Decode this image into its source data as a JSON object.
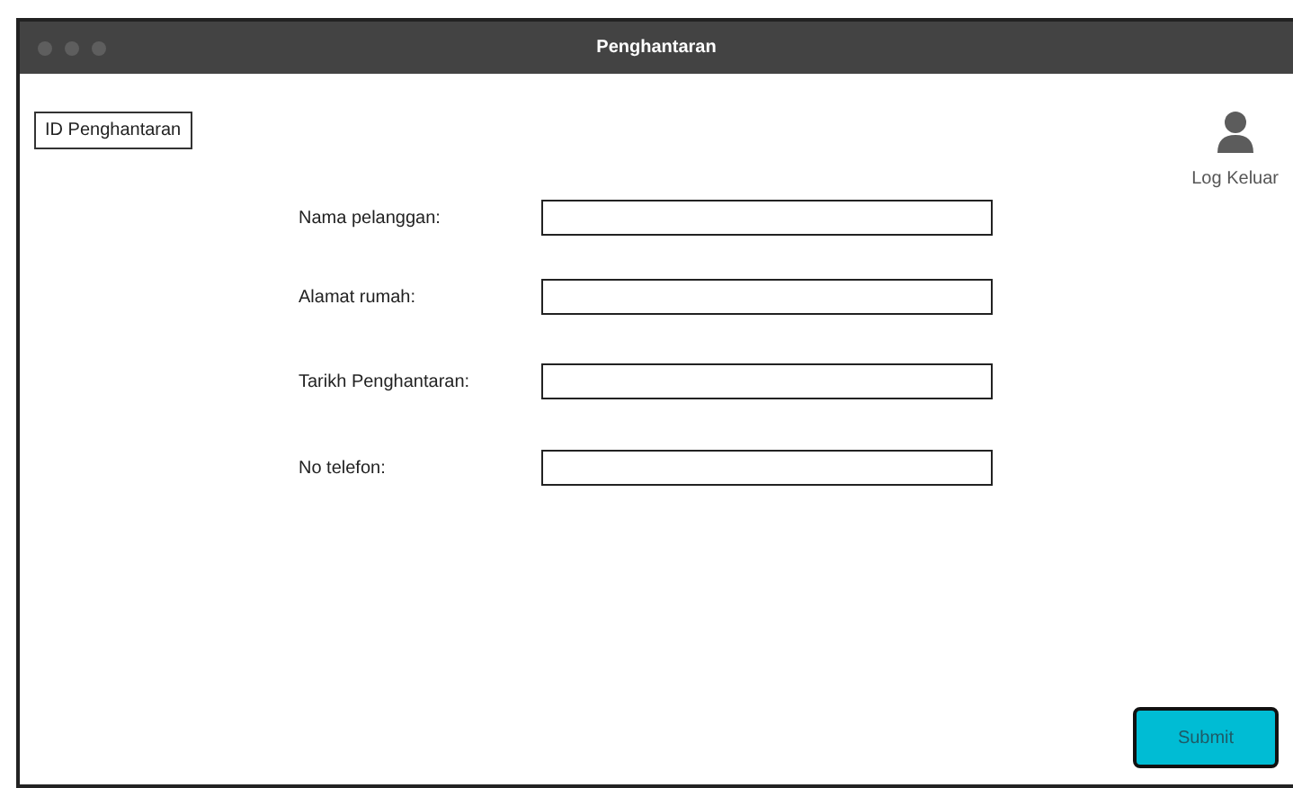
{
  "window": {
    "title": "Penghantaran"
  },
  "id_label": "ID Penghantaran",
  "logout": {
    "label": "Log Keluar"
  },
  "form": {
    "fields": [
      {
        "label": "Nama pelanggan:"
      },
      {
        "label": "Alamat rumah:"
      },
      {
        "label": "Tarikh Penghantaran:"
      },
      {
        "label": "No telefon:"
      }
    ]
  },
  "buttons": [
    {
      "label": "Submit"
    }
  ]
}
